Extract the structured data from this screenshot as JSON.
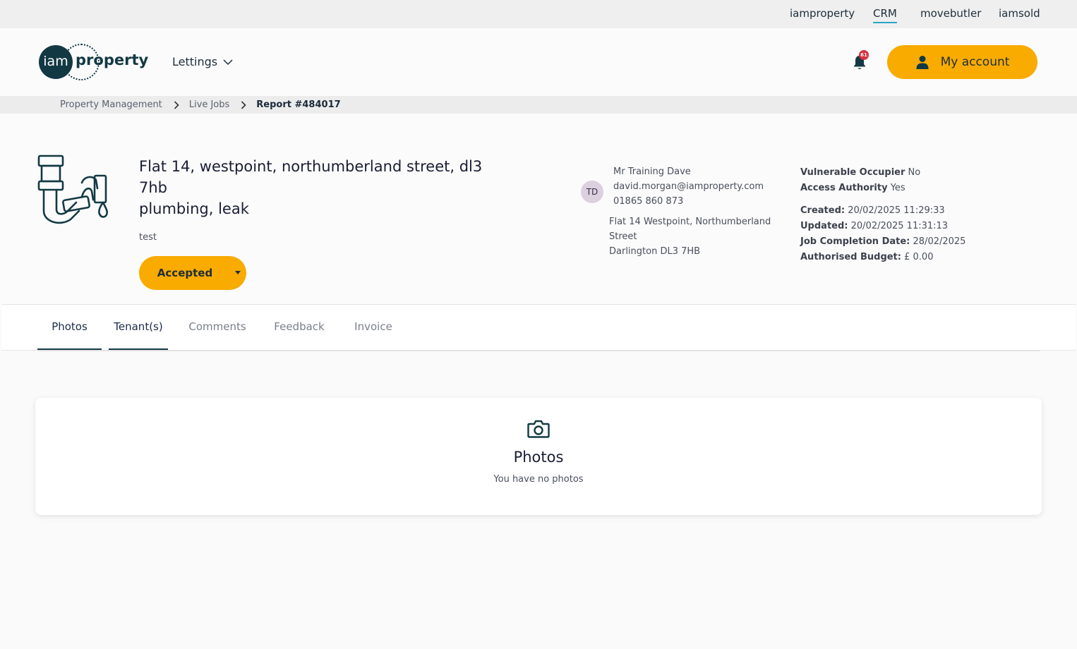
{
  "topbar": {
    "links": [
      "iamproperty",
      "CRM",
      "movebutler",
      "iamsold"
    ]
  },
  "header": {
    "logo_circle": "iam",
    "logo_text": "property",
    "nav_lettings": "Lettings",
    "notification_count": "61",
    "account_label": "My account"
  },
  "breadcrumb": {
    "items": [
      "Property Management",
      "Live Jobs",
      "Report #484017"
    ]
  },
  "job": {
    "title_line1": "Flat 14, westpoint, northumberland street, dl3",
    "title_line2": "7hb",
    "title_line3": "plumbing, leak",
    "description": "test",
    "status": "Accepted"
  },
  "contact": {
    "initials": "TD",
    "name": "Mr Training Dave",
    "email": "david.morgan@iamproperty.com",
    "phone": "01865 860 873",
    "address_line1": "Flat 14 Westpoint, Northumberland",
    "address_line2": "Street",
    "address_line3": "Darlington DL3 7HB"
  },
  "meta": {
    "vulnerable_label": "Vulnerable Occupier",
    "vulnerable_value": "No",
    "access_label": "Access Authority",
    "access_value": "Yes",
    "created_label": "Created:",
    "created_value": "20/02/2025 11:29:33",
    "updated_label": "Updated:",
    "updated_value": "20/02/2025 11:31:13",
    "completion_label": "Job Completion Date:",
    "completion_value": "28/02/2025",
    "budget_label": "Authorised Budget:",
    "budget_value": "£ 0.00"
  },
  "tabs": [
    "Photos",
    "Tenant(s)",
    "Comments",
    "Feedback",
    "Invoice"
  ],
  "photos_card": {
    "title": "Photos",
    "subtitle": "You have no photos"
  },
  "colors": {
    "accent": "#f9ab00",
    "brand": "#123943",
    "badge": "#d9303e"
  }
}
